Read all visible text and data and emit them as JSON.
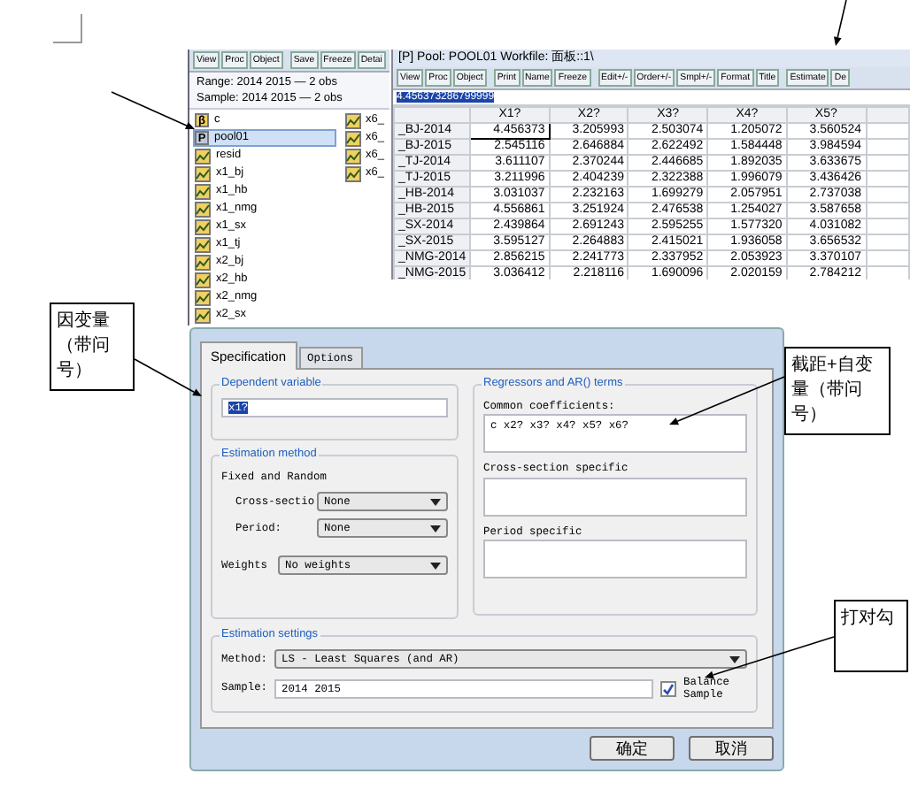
{
  "workfile_window": {
    "toolbar": [
      "View",
      "Proc",
      "Object",
      "Save",
      "Freeze",
      "Detai"
    ],
    "range": "Range:  2014 2015  —  2 obs",
    "sample": "Sample: 2014 2015  —  2 obs",
    "objects": [
      {
        "label": "c",
        "kind": "coef",
        "icon_text": "β",
        "selected": false
      },
      {
        "label": "pool01",
        "kind": "pool",
        "icon_text": "P",
        "selected": true
      },
      {
        "label": "resid",
        "kind": "series",
        "selected": false
      },
      {
        "label": "x1_bj",
        "kind": "series",
        "selected": false
      },
      {
        "label": "x1_hb",
        "kind": "series",
        "selected": false
      },
      {
        "label": "x1_nmg",
        "kind": "series",
        "selected": false
      },
      {
        "label": "x1_sx",
        "kind": "series",
        "selected": false
      },
      {
        "label": "x1_tj",
        "kind": "series",
        "selected": false
      },
      {
        "label": "x2_bj",
        "kind": "series",
        "selected": false
      },
      {
        "label": "x2_hb",
        "kind": "series",
        "selected": false
      },
      {
        "label": "x2_nmg",
        "kind": "series",
        "selected": false
      },
      {
        "label": "x2_sx",
        "kind": "series",
        "selected": false
      }
    ],
    "objects_column_2": [
      {
        "label": "x6_",
        "kind": "series",
        "selected": false
      },
      {
        "label": "x6_",
        "kind": "series",
        "selected": false
      },
      {
        "label": "x6_",
        "kind": "series",
        "selected": false
      },
      {
        "label": "x6_",
        "kind": "series",
        "selected": false
      }
    ]
  },
  "pool_window": {
    "title": "[P] Pool: POOL01   Workfile: 面板::1\\",
    "toolbar": [
      [
        "View",
        "Proc",
        "Object"
      ],
      [
        "Print",
        "Name",
        "Freeze"
      ],
      [
        "Edit+/-",
        "Order+/-",
        "Smpl+/-",
        "Format",
        "Title"
      ],
      [
        "Estimate",
        "De"
      ]
    ],
    "edit_line": {
      "value": "4.456373286799999",
      "highlighted": true
    },
    "columns": [
      "X1?",
      "X2?",
      "X3?",
      "X4?",
      "X5?"
    ],
    "rows": [
      {
        "label": "_BJ-2014",
        "cells": [
          {
            "value": "4.456373",
            "selected": true
          },
          {
            "value": "3.205993",
            "selected": false
          },
          {
            "value": "2.503074",
            "selected": false
          },
          {
            "value": "1.205072",
            "selected": false
          },
          {
            "value": "3.560524",
            "selected": false
          }
        ]
      },
      {
        "label": "_BJ-2015",
        "cells": [
          {
            "value": "2.545116",
            "selected": false
          },
          {
            "value": "2.646884",
            "selected": false
          },
          {
            "value": "2.622492",
            "selected": false
          },
          {
            "value": "1.584448",
            "selected": false
          },
          {
            "value": "3.984594",
            "selected": false
          }
        ]
      },
      {
        "label": "_TJ-2014",
        "cells": [
          {
            "value": "3.611107",
            "selected": false
          },
          {
            "value": "2.370244",
            "selected": false
          },
          {
            "value": "2.446685",
            "selected": false
          },
          {
            "value": "1.892035",
            "selected": false
          },
          {
            "value": "3.633675",
            "selected": false
          }
        ]
      },
      {
        "label": "_TJ-2015",
        "cells": [
          {
            "value": "3.211996",
            "selected": false
          },
          {
            "value": "2.404239",
            "selected": false
          },
          {
            "value": "2.322388",
            "selected": false
          },
          {
            "value": "1.996079",
            "selected": false
          },
          {
            "value": "3.436426",
            "selected": false
          }
        ]
      },
      {
        "label": "_HB-2014",
        "cells": [
          {
            "value": "3.031037",
            "selected": false
          },
          {
            "value": "2.232163",
            "selected": false
          },
          {
            "value": "1.699279",
            "selected": false
          },
          {
            "value": "2.057951",
            "selected": false
          },
          {
            "value": "2.737038",
            "selected": false
          }
        ]
      },
      {
        "label": "_HB-2015",
        "cells": [
          {
            "value": "4.556861",
            "selected": false
          },
          {
            "value": "3.251924",
            "selected": false
          },
          {
            "value": "2.476538",
            "selected": false
          },
          {
            "value": "1.254027",
            "selected": false
          },
          {
            "value": "3.587658",
            "selected": false
          }
        ]
      },
      {
        "label": "_SX-2014",
        "cells": [
          {
            "value": "2.439864",
            "selected": false
          },
          {
            "value": "2.691243",
            "selected": false
          },
          {
            "value": "2.595255",
            "selected": false
          },
          {
            "value": "1.577320",
            "selected": false
          },
          {
            "value": "4.031082",
            "selected": false
          }
        ]
      },
      {
        "label": "_SX-2015",
        "cells": [
          {
            "value": "3.595127",
            "selected": false
          },
          {
            "value": "2.264883",
            "selected": false
          },
          {
            "value": "2.415021",
            "selected": false
          },
          {
            "value": "1.936058",
            "selected": false
          },
          {
            "value": "3.656532",
            "selected": false
          }
        ]
      },
      {
        "label": "_NMG-2014",
        "cells": [
          {
            "value": "2.856215",
            "selected": false
          },
          {
            "value": "2.241773",
            "selected": false
          },
          {
            "value": "2.337952",
            "selected": false
          },
          {
            "value": "2.053923",
            "selected": false
          },
          {
            "value": "3.370107",
            "selected": false
          }
        ]
      },
      {
        "label": "_NMG-2015",
        "cells": [
          {
            "value": "3.036412",
            "selected": false
          },
          {
            "value": "2.218116",
            "selected": false
          },
          {
            "value": "1.690096",
            "selected": false
          },
          {
            "value": "2.020159",
            "selected": false
          },
          {
            "value": "2.784212",
            "selected": false
          }
        ]
      }
    ]
  },
  "dialog": {
    "tabs": [
      {
        "label": "Specification",
        "selected": true
      },
      {
        "label": "Options",
        "selected": false
      }
    ],
    "dependent_variable": {
      "title": "Dependent variable",
      "value": "x1?",
      "highlighted": true
    },
    "estimation_method": {
      "title": "Estimation method",
      "subtitle": "Fixed and Random",
      "fields": [
        {
          "label": "Cross-sectio",
          "value": "None"
        },
        {
          "label": "Period:",
          "value": "None"
        },
        {
          "label": "Weights",
          "value": "No weights"
        }
      ]
    },
    "regressors": {
      "title": "Regressors and AR() terms",
      "fields": [
        {
          "label": "Common coefficients:",
          "value": "c x2? x3? x4? x5? x6?"
        },
        {
          "label": "Cross-section specific"
        },
        {
          "label": "Period specific"
        }
      ]
    },
    "estimation_settings": {
      "title": "Estimation settings",
      "method_label": "Method:",
      "method": "LS  -  Least Squares (and AR)",
      "sample_label": "Sample:",
      "sample": "2014 2015",
      "balance": {
        "label": "Balance Sample",
        "checked": true
      }
    },
    "buttons": [
      "确定",
      "取消"
    ]
  },
  "callouts": [
    {
      "text": "因变量（带问号）"
    },
    {
      "text": "截距+自变量（带问号）"
    },
    {
      "text": "打对勾"
    }
  ]
}
